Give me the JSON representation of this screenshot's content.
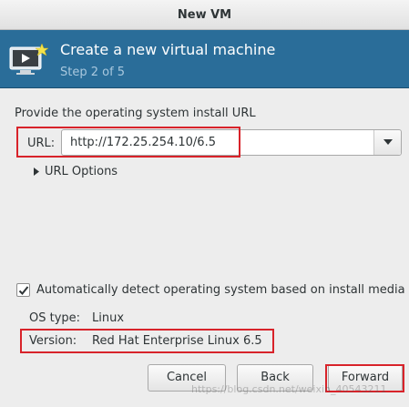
{
  "window": {
    "title": "New VM"
  },
  "header": {
    "title": "Create a new virtual machine",
    "step": "Step 2 of 5",
    "icon": "virtual-machine-monitor-icon"
  },
  "form": {
    "prompt": "Provide the operating system install URL",
    "url_label": "URL:",
    "url_value": "http://172.25.254.10/6.5",
    "url_options_label": "URL Options",
    "auto_detect_label": "Automatically detect operating system based on install media",
    "auto_detect_checked": true,
    "os_type_label": "OS type:",
    "os_type_value": "Linux",
    "version_label": "Version:",
    "version_value": "Red Hat Enterprise Linux 6.5"
  },
  "buttons": {
    "cancel": "Cancel",
    "back": "Back",
    "forward": "Forward"
  },
  "watermark": "https://blog.csdn.net/weixin_40543211",
  "colors": {
    "header_bg": "#2a6d99",
    "highlight": "#d8232a"
  }
}
